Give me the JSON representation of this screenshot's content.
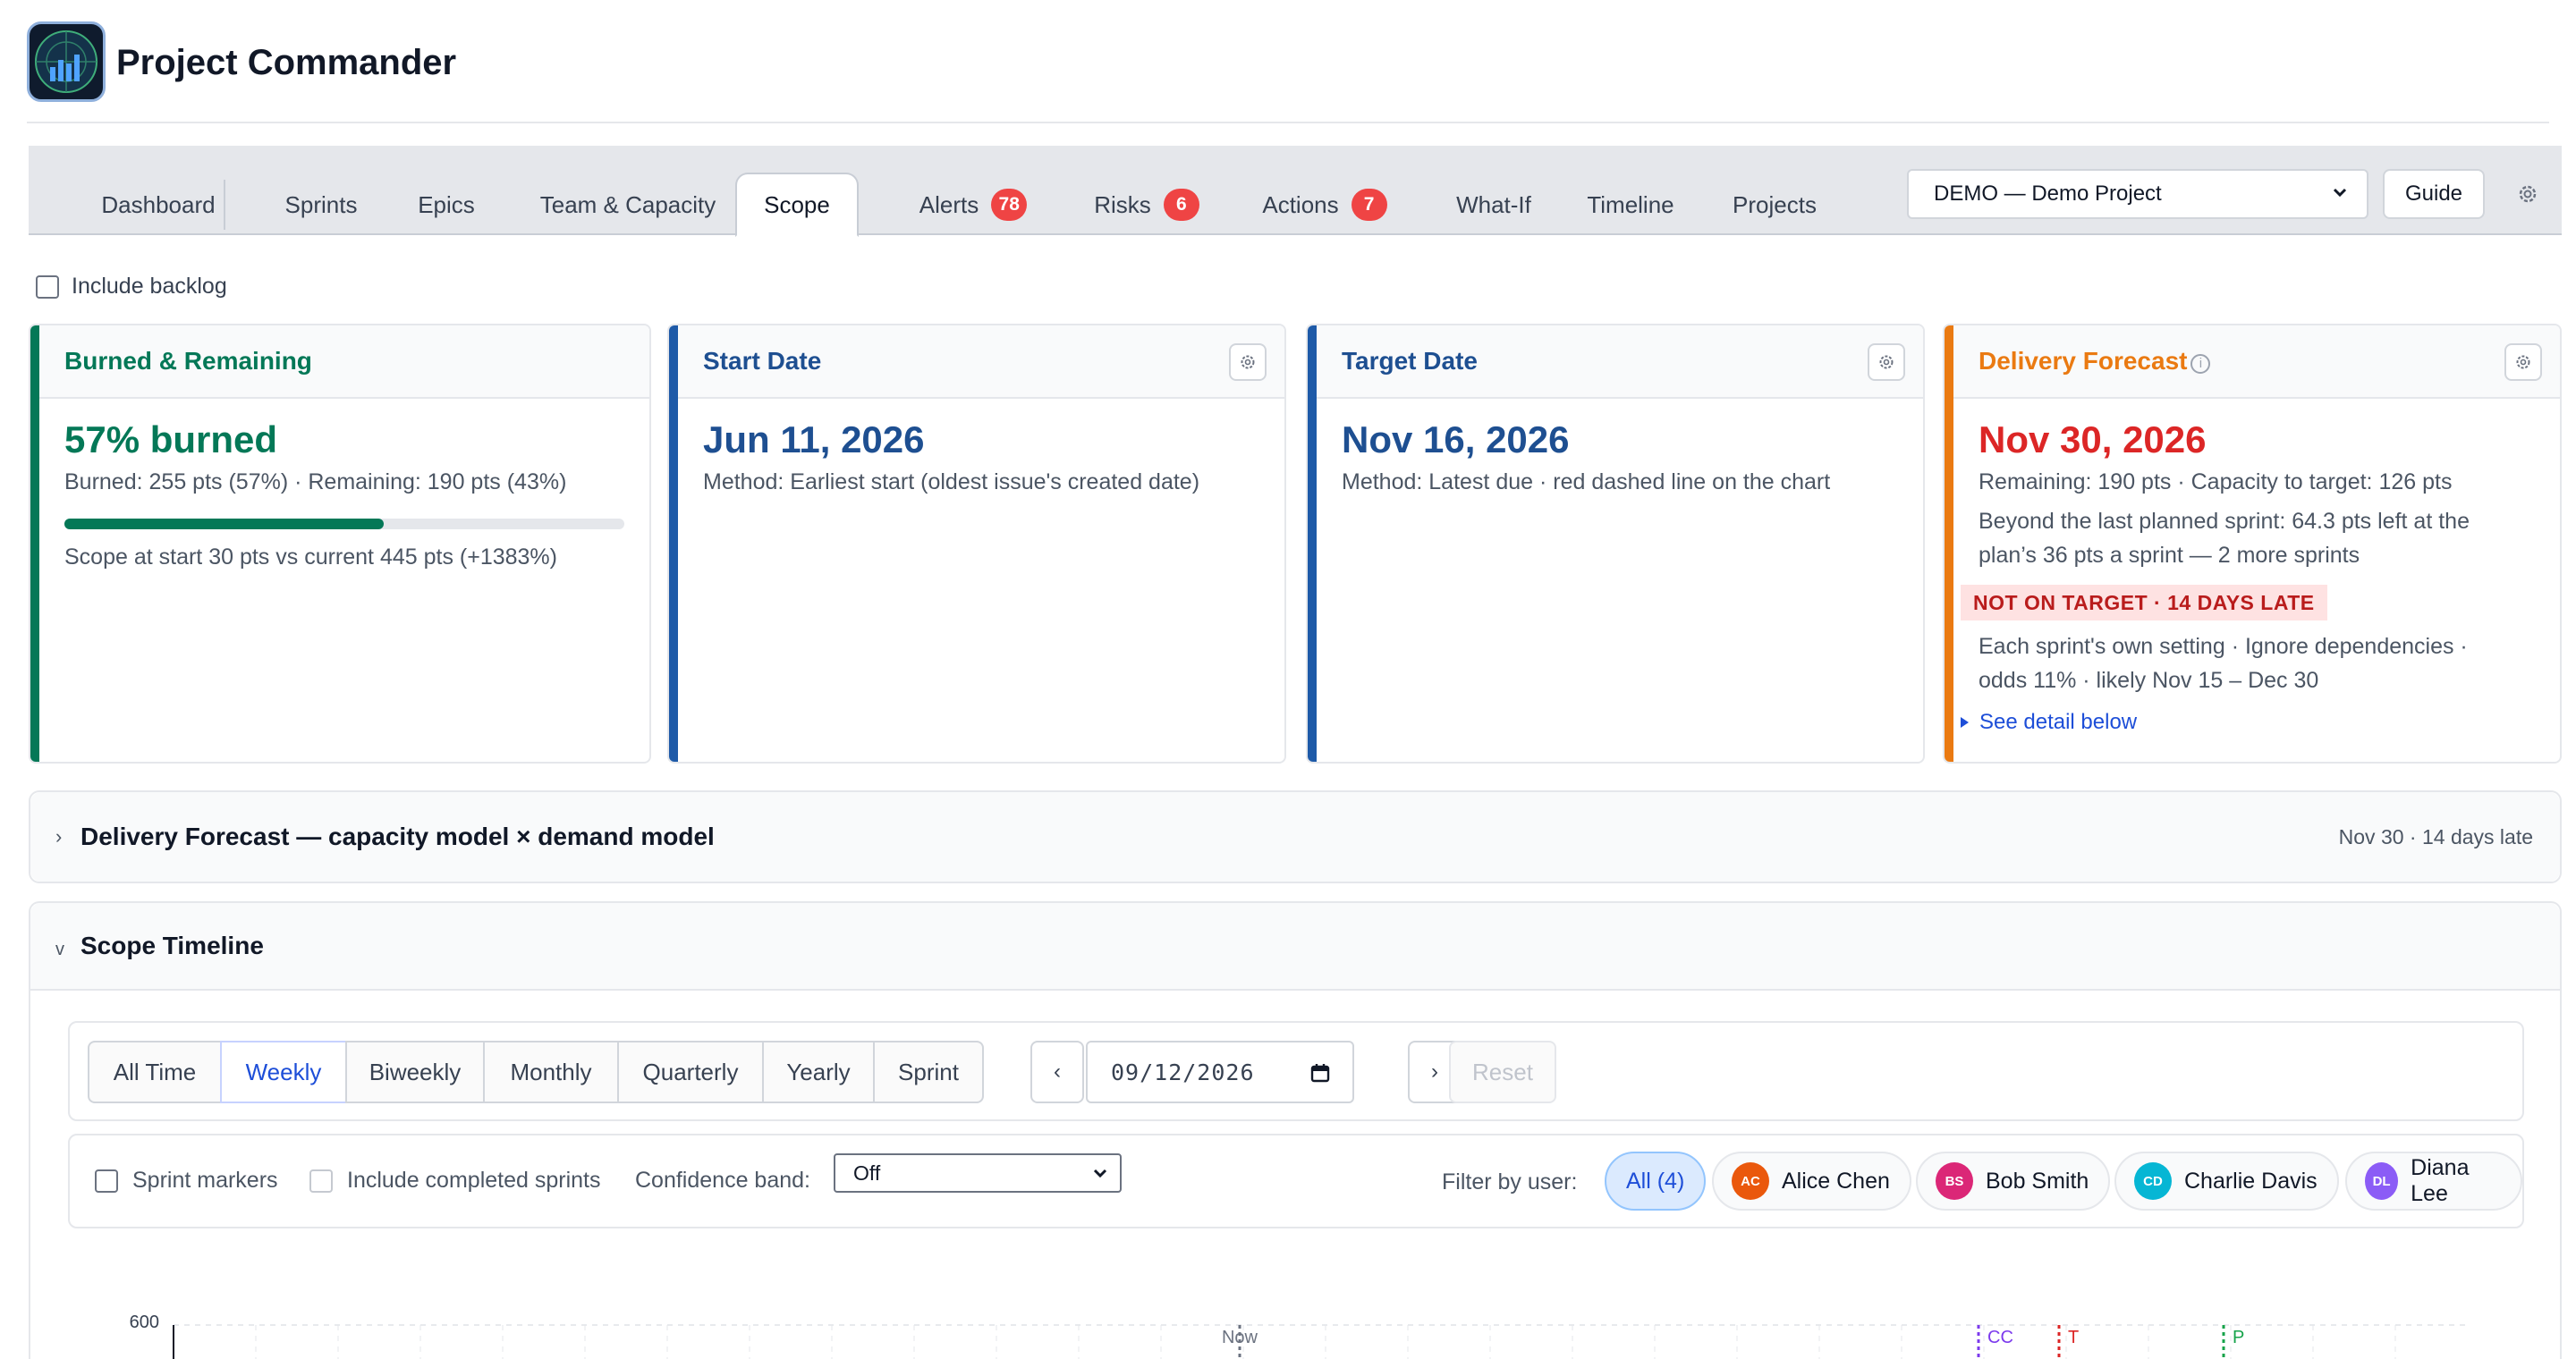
{
  "app": {
    "title": "Project Commander"
  },
  "tabs": [
    {
      "label": "Dashboard"
    },
    {
      "label": "Sprints"
    },
    {
      "label": "Epics"
    },
    {
      "label": "Team & Capacity"
    },
    {
      "label": "Scope",
      "active": true
    },
    {
      "label": "Alerts",
      "badge": "78"
    },
    {
      "label": "Risks",
      "badge": "6"
    },
    {
      "label": "Actions",
      "badge": "7"
    },
    {
      "label": "What-If"
    },
    {
      "label": "Timeline"
    },
    {
      "label": "Projects"
    }
  ],
  "toolbar": {
    "project_select": "DEMO — Demo Project",
    "guide_label": "Guide"
  },
  "backlog": {
    "label": "Include backlog",
    "checked": false
  },
  "cards": {
    "burned": {
      "title": "Burned & Remaining",
      "headline": "57% burned",
      "detail": "Burned: 255 pts (57%) · Remaining: 190 pts (43%)",
      "progress": 0.57,
      "scope_note": "Scope at start 30 pts vs current 445 pts (+1383%)",
      "color": "#047857"
    },
    "start": {
      "title": "Start Date",
      "date": "Jun 11, 2026",
      "method": "Method: Earliest start (oldest issue's created date)",
      "color": "#1e5aa8"
    },
    "target": {
      "title": "Target Date",
      "date": "Nov 16, 2026",
      "method": "Method: Latest due · red dashed line on the chart",
      "color": "#1e5aa8"
    },
    "forecast": {
      "title": "Delivery Forecast",
      "date": "Nov 30, 2026",
      "line1": "Remaining: 190 pts · Capacity to target: 126 pts",
      "line2": "Beyond the last planned sprint: 64.3 pts left at the",
      "line3": "plan’s 36 pts a sprint — 2 more sprints",
      "tag": "NOT ON TARGET · 14 DAYS LATE",
      "line4": "Each sprint's own setting · Ignore dependencies ·",
      "line5": "odds 11% · likely Nov 15 – Dec 30",
      "link": "See detail below",
      "color": "#ea7a12",
      "date_color": "#dc2626"
    }
  },
  "forecast_section": {
    "title": "Delivery Forecast — capacity model × demand model",
    "meta": "Nov 30 · 14 days late"
  },
  "scope_timeline": {
    "title": "Scope Timeline",
    "ranges": [
      "All Time",
      "Weekly",
      "Biweekly",
      "Monthly",
      "Quarterly",
      "Yearly",
      "Sprint"
    ],
    "active_range": "Weekly",
    "prev": "‹",
    "next": "›",
    "date_value": "09/12/2026",
    "reset_label": "Reset",
    "sprint_markers_label": "Sprint markers",
    "include_completed_label": "Include completed sprints",
    "confidence_label": "Confidence band:",
    "confidence_value": "Off",
    "filter_label": "Filter by user:",
    "users": [
      {
        "label": "All (4)",
        "active": true
      },
      {
        "initials": "AC",
        "name": "Alice Chen",
        "color": "#ea580c"
      },
      {
        "initials": "BS",
        "name": "Bob Smith",
        "color": "#db2777"
      },
      {
        "initials": "CD",
        "name": "Charlie Davis",
        "color": "#06b6d4"
      },
      {
        "initials": "DL",
        "name": "Diana Lee",
        "color": "#8b5cf6"
      }
    ]
  },
  "chart_data": {
    "type": "line",
    "y_tick_top": "600",
    "markers": [
      {
        "label": "Now",
        "color": "#6b7280"
      },
      {
        "label": "CC",
        "color": "#7c3aed"
      },
      {
        "label": "T",
        "color": "#dc2626"
      },
      {
        "label": "P",
        "color": "#16a34a"
      }
    ]
  }
}
